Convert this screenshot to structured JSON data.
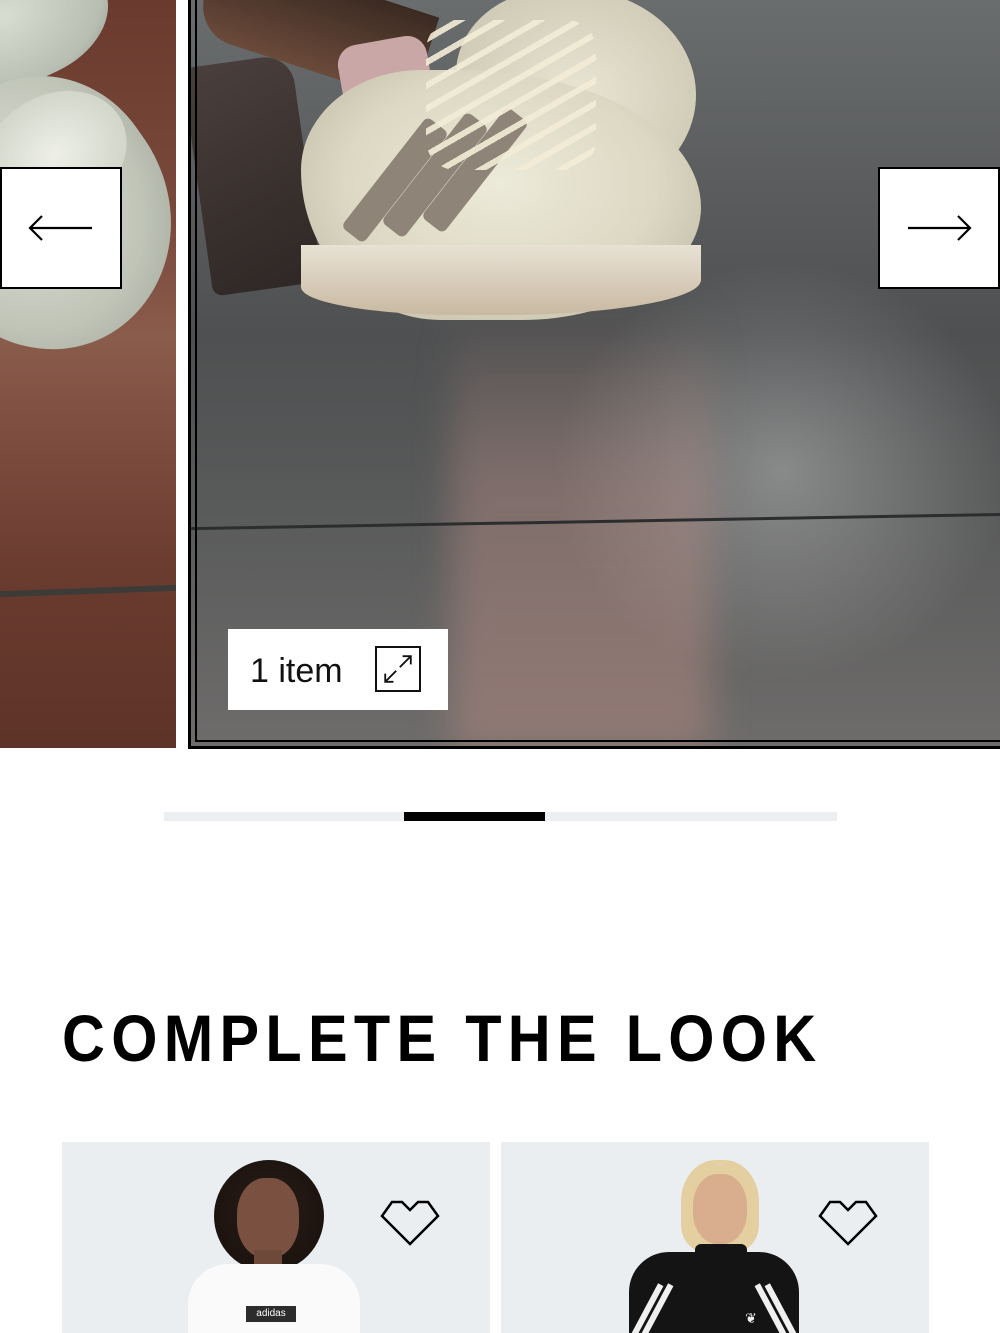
{
  "carousel": {
    "item_badge": {
      "label": "1 item",
      "icon": "expand-icon"
    },
    "prev_button": {
      "icon": "arrow-left-icon"
    },
    "next_button": {
      "icon": "arrow-right-icon"
    },
    "progress": {
      "position": 0.356,
      "size": 0.21
    }
  },
  "section": {
    "title": "COMPLETE THE LOOK"
  },
  "products": [
    {
      "logo_text": "adidas",
      "wishlist_icon": "heart-icon"
    },
    {
      "logo_text": "",
      "wishlist_icon": "heart-icon"
    }
  ],
  "colors": {
    "accent": "#000000",
    "card_background": "#eaeef0",
    "track": "#eceff1"
  }
}
